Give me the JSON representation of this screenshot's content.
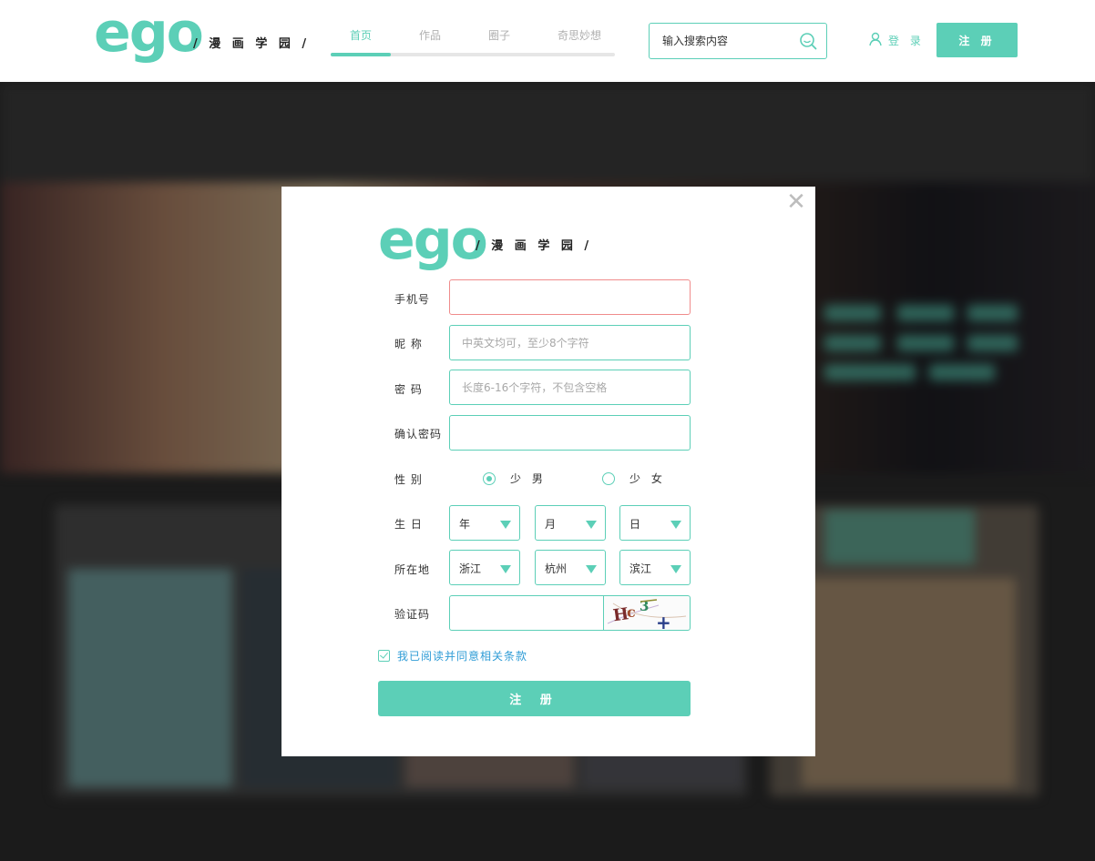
{
  "colors": {
    "accent": "#5ccfb7",
    "link": "#2f9cd6",
    "error_border": "#f08c8c"
  },
  "header": {
    "logo": "ego",
    "logo_sub": "/ 漫 画 学 园 /",
    "nav": [
      {
        "label": "首页",
        "active": true
      },
      {
        "label": "作品",
        "active": false
      },
      {
        "label": "圈子",
        "active": false
      },
      {
        "label": "奇思妙想",
        "active": false
      }
    ],
    "nav_progress": 0.21,
    "search_placeholder": "输入搜索内容",
    "search_icon": "search-icon",
    "login_icon": "user-icon",
    "login_label": "登 录",
    "register_label": "注 册"
  },
  "modal": {
    "close_icon": "close-icon",
    "logo": "ego",
    "logo_sub": "/ 漫 画 学 园 /",
    "phone_label": "手机号",
    "phone_value": "",
    "nickname_label": "昵 称",
    "nickname_placeholder": "中英文均可，至少8个字符",
    "password_label": "密 码",
    "password_placeholder": "长度6-16个字符，不包含空格",
    "confirm_label": "确认密码",
    "gender_label": "性 别",
    "gender_options": [
      {
        "label": "少 男",
        "selected": true
      },
      {
        "label": "少 女",
        "selected": false
      }
    ],
    "birthday_label": "生 日",
    "birthday": {
      "year": "年",
      "month": "月",
      "day": "日"
    },
    "location_label": "所在地",
    "location": {
      "province": "浙江",
      "city": "杭州",
      "district": "滨江"
    },
    "captcha_label": "验证码",
    "captcha_text": "Hc3+",
    "agree_label": "我已阅读并同意相关条款",
    "agree_checked": true,
    "submit_label": "注 册"
  }
}
